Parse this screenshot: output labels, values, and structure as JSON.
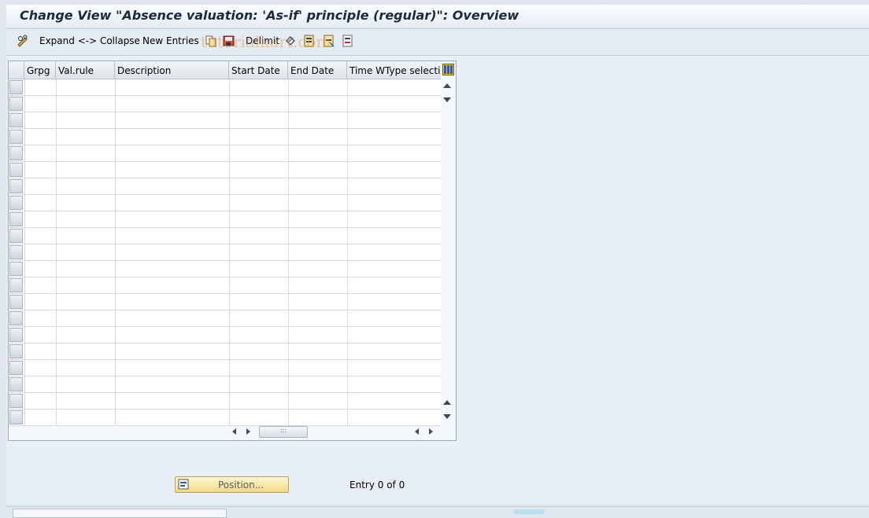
{
  "header": {
    "title": "Change View \"Absence valuation: 'As-if' principle (regular)\": Overview"
  },
  "toolbar": {
    "expand_collapse": "Expand <-> Collapse",
    "new_entries": "New Entries",
    "delimit": "Delimit",
    "icons": [
      "pencil-glasses-icon",
      "copy-icon",
      "save-icon",
      "delimit-icon",
      "undo-icon",
      "select-all-icon",
      "deselect-icon",
      "select-block-icon"
    ]
  },
  "table": {
    "columns": [
      "Grpg",
      "Val.rule",
      "Description",
      "Start Date",
      "End Date",
      "Time WType selectio"
    ],
    "row_count": 21,
    "scroll_thumb": ":::"
  },
  "footer": {
    "position_button": "Position...",
    "entry_text": "Entry 0 of 0"
  },
  "watermark": "tutorialkart.com",
  "colors": {
    "position_button_fill": "#f2d98a",
    "title_text": "#1b2a3d"
  }
}
